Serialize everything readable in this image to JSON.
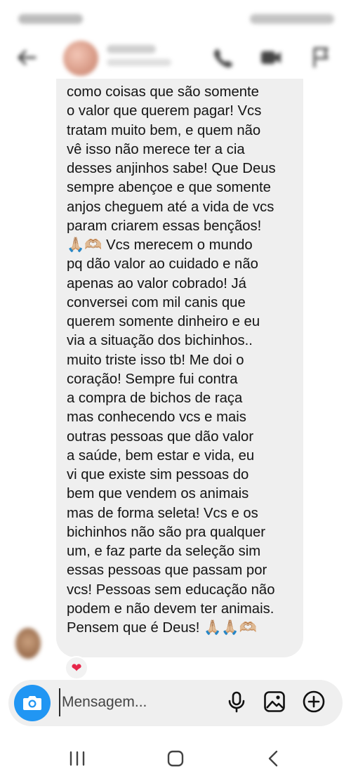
{
  "message": {
    "lines": [
      "como coisas que são somente",
      "o valor que querem pagar! Vcs",
      "tratam muito bem, e quem não",
      "vê isso não merece ter a cia",
      "desses anjinhos sabe! Que Deus",
      "sempre abençoe e que somente",
      "anjos cheguem até a vida de vcs",
      "param criarem essas bençãos!",
      "🙏🏼🫶🏼 Vcs merecem o mundo",
      "pq dão valor ao cuidado e não",
      "apenas ao valor cobrado! Já",
      "conversei com mil canis que",
      "querem somente dinheiro e eu",
      "via a situação dos bichinhos..",
      "muito triste isso tb! Me doi o",
      "coração! Sempre fui contra",
      "a compra de bichos de raça",
      "mas conhecendo vcs e mais",
      "outras pessoas que dão valor",
      "a saúde, bem estar e vida, eu",
      "vi que existe sim pessoas do",
      "bem que vendem os animais",
      "mas de forma seleta! Vcs e os",
      "bichinhos não são pra qualquer",
      "um, e faz parte da seleção sim",
      "essas pessoas que passam por",
      "vcs! Pessoas sem educação não",
      "podem e não devem ter animais.",
      "Pensem que é Deus! 🙏🏼🙏🏼🫶🏼"
    ],
    "reaction": "❤"
  },
  "composer": {
    "placeholder": "Mensagem..."
  },
  "icons": {
    "header": [
      "back-arrow-icon",
      "phone-icon",
      "video-call-icon",
      "flag-icon"
    ],
    "composer": [
      "camera-icon",
      "microphone-icon",
      "gallery-icon",
      "plus-circle-icon"
    ],
    "navigation": [
      "recent-apps-icon",
      "home-icon",
      "back-icon"
    ]
  },
  "colors": {
    "accent": "#2196f3",
    "bubble": "#efefef",
    "reaction": "#e6264a"
  }
}
